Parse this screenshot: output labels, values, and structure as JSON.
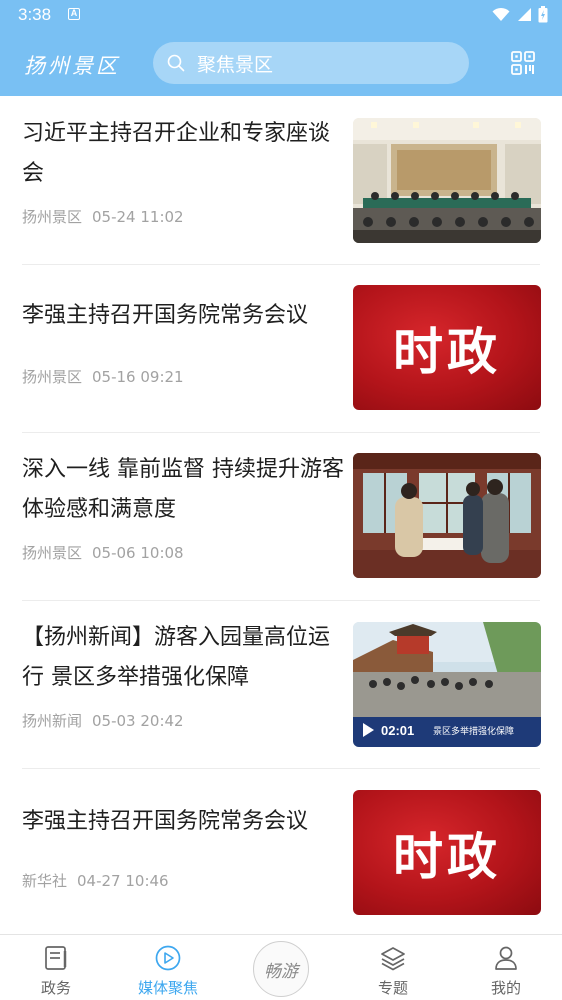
{
  "status": {
    "time": "3:38",
    "notif_glyph": "A"
  },
  "header": {
    "brand": "扬州景区",
    "search_placeholder": "聚焦景区"
  },
  "icons": {
    "search": "search-icon",
    "qr": "qr-scan-icon"
  },
  "colors": {
    "header_bg": "#79c0f3",
    "accent": "#3da7ef",
    "meta_text": "#a2a2a2"
  },
  "feed": [
    {
      "title": "习近平主持召开企业和专家座谈会",
      "source": "扬州景区",
      "time": "05-24 11:02",
      "thumb": "photo"
    },
    {
      "title": "李强主持召开国务院常务会议",
      "source": "扬州景区",
      "time": "05-16 09:21",
      "thumb": "时政"
    },
    {
      "title": "深入一线 靠前监督 持续提升游客体验感和满意度",
      "source": "扬州景区",
      "time": "05-06 10:08",
      "thumb": "photo"
    },
    {
      "title": "【扬州新闻】游客入园量高位运行 景区多举措强化保障",
      "source": "扬州新闻",
      "time": "05-03 20:42",
      "thumb": "video",
      "video_duration": "02:01",
      "video_caption": "景区多举措强化保障"
    },
    {
      "title": "李强主持召开国务院常务会议",
      "source": "新华社",
      "time": "04-27 10:46",
      "thumb": "时政"
    }
  ],
  "tabs": [
    {
      "label": "政务",
      "icon": "document-icon",
      "active": false
    },
    {
      "label": "媒体聚焦",
      "icon": "play-circle-icon",
      "active": true
    },
    {
      "label": "畅游",
      "icon": "app-logo",
      "active": false
    },
    {
      "label": "专题",
      "icon": "layers-icon",
      "active": false
    },
    {
      "label": "我的",
      "icon": "user-icon",
      "active": false
    }
  ]
}
